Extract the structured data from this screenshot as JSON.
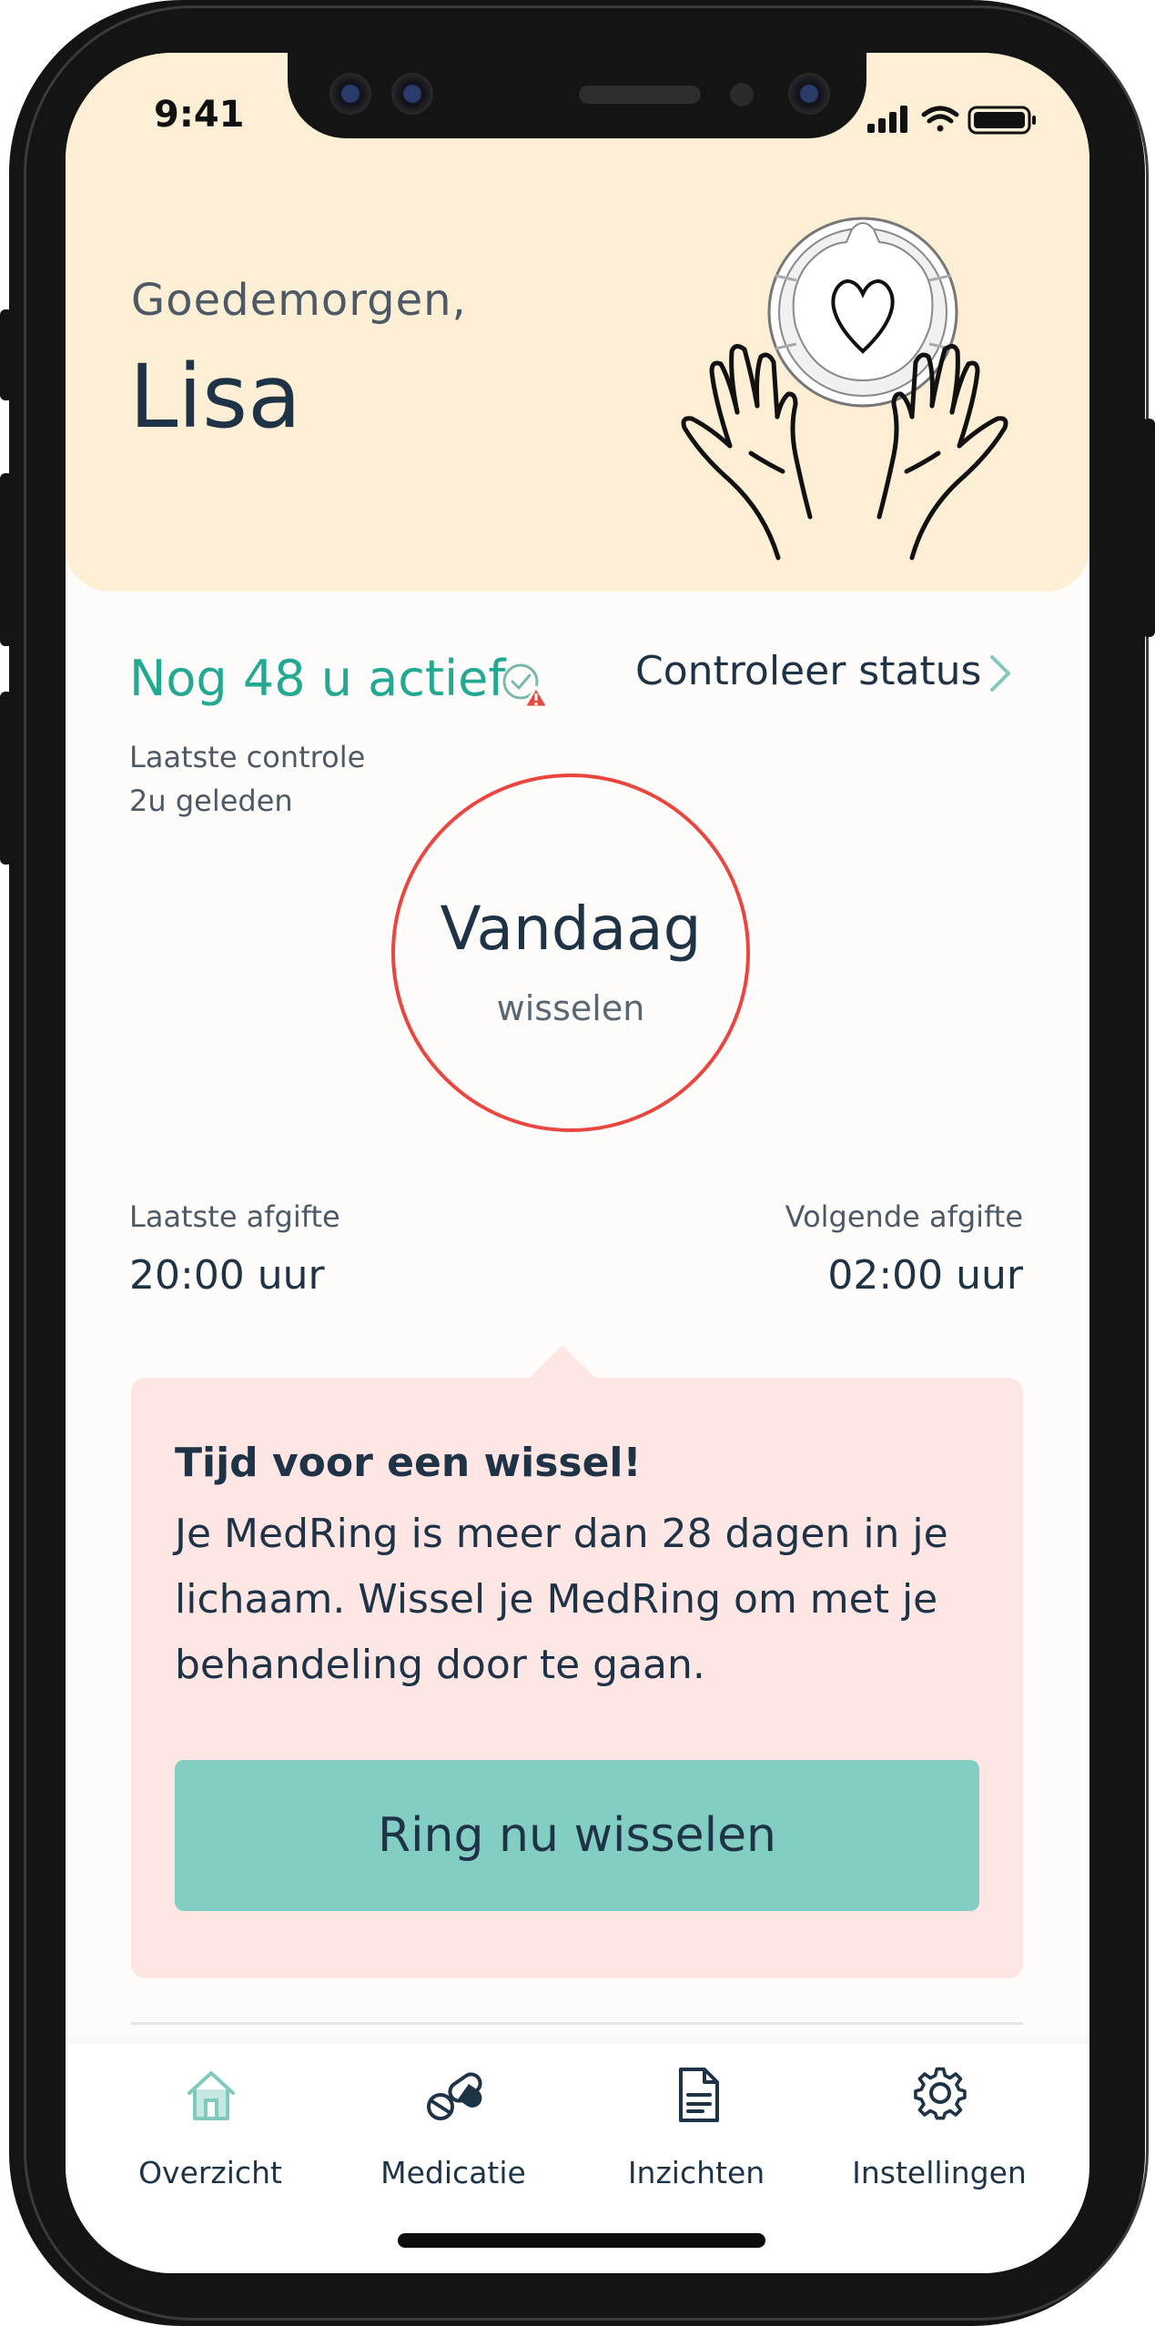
{
  "status_bar": {
    "time": "9:41"
  },
  "header": {
    "greeting": "Goedemorgen,",
    "name": "Lisa"
  },
  "status": {
    "active_text": "Nog 48 u actief",
    "check_link": "Controleer status",
    "last_check_label": "Laatste controle",
    "last_check_value": "2u geleden"
  },
  "ring": {
    "title": "Vandaag",
    "subtitle": "wisselen"
  },
  "dispense": {
    "last_label": "Laatste afgifte",
    "last_value": "20:00 uur",
    "next_label": "Volgende afgifte",
    "next_value": "02:00 uur"
  },
  "alert": {
    "title": "Tijd voor een wissel!",
    "body": "Je MedRing is meer dan 28 dagen in je lichaam. Wissel je MedRing om met je behandeling door te gaan.",
    "button": "Ring nu wisselen"
  },
  "tabs": [
    {
      "label": "Overzicht",
      "icon": "home-icon",
      "active": true
    },
    {
      "label": "Medicatie",
      "icon": "pills-icon",
      "active": false
    },
    {
      "label": "Inzichten",
      "icon": "document-icon",
      "active": false
    },
    {
      "label": "Instellingen",
      "icon": "gear-icon",
      "active": false
    }
  ],
  "colors": {
    "header_bg": "#fdefd5",
    "accent_green": "#23a991",
    "alert_red": "#e8463f",
    "alert_bg": "#fde6e4",
    "button_bg": "#82cec2",
    "text_dark": "#1f3347"
  }
}
